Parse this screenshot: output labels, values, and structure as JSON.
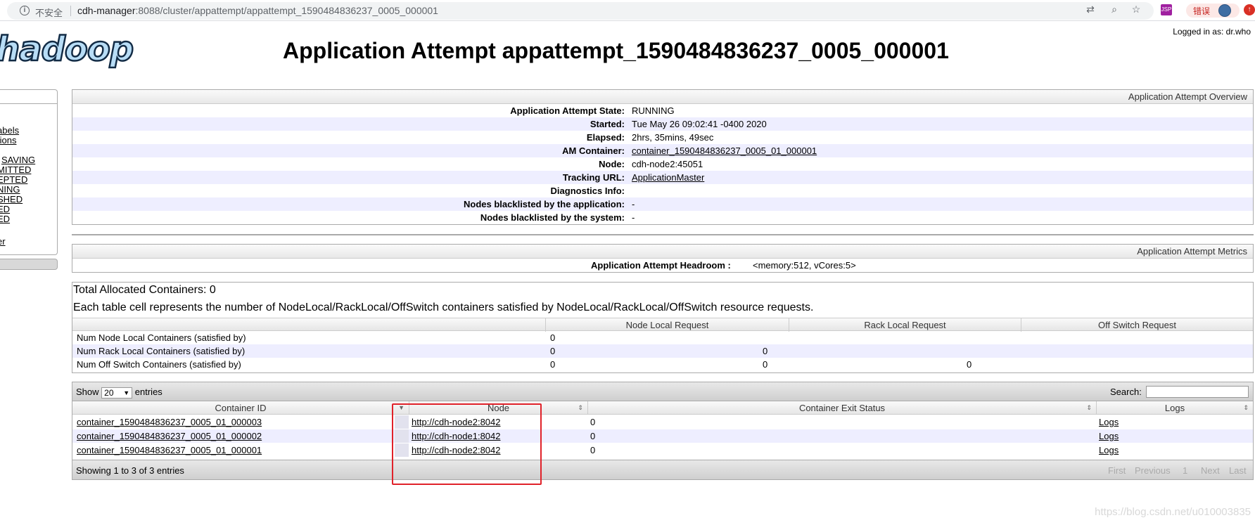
{
  "browser": {
    "security_label": "不安全",
    "url_host": "cdh-manager",
    "url_rest": ":8088/cluster/appattempt/appattempt_1590484836237_0005_000001",
    "error_label": "错误",
    "icons": [
      "info-icon",
      "translate-icon",
      "zoom-icon",
      "star-icon",
      "extension-icon",
      "avatar-icon",
      "update-icon"
    ]
  },
  "header": {
    "logged_in": "Logged in as: dr.who",
    "logo_text": "hadoop",
    "title": "Application Attempt appattempt_1590484836237_0005_000001"
  },
  "nav": {
    "items": [
      "abels",
      "tions",
      "",
      "SAVING",
      "MITTED",
      "EPTED",
      "NING",
      "SHED",
      "ED",
      "ED",
      "er"
    ]
  },
  "overview": {
    "heading": "Application Attempt Overview",
    "rows": [
      {
        "key": "Application Attempt State:",
        "value": "RUNNING",
        "link": false
      },
      {
        "key": "Started:",
        "value": "Tue May 26 09:02:41 -0400 2020",
        "link": false
      },
      {
        "key": "Elapsed:",
        "value": "2hrs, 35mins, 49sec",
        "link": false
      },
      {
        "key": "AM Container:",
        "value": "container_1590484836237_0005_01_000001",
        "link": true
      },
      {
        "key": "Node:",
        "value": "cdh-node2:45051",
        "link": false
      },
      {
        "key": "Tracking URL:",
        "value": "ApplicationMaster",
        "link": true
      },
      {
        "key": "Diagnostics Info:",
        "value": "",
        "link": false
      },
      {
        "key": "Nodes blacklisted by the application:",
        "value": "-",
        "link": false
      },
      {
        "key": "Nodes blacklisted by the system:",
        "value": "-",
        "link": false
      }
    ]
  },
  "metrics": {
    "heading": "Application Attempt Metrics",
    "headroom_key": "Application Attempt Headroom :",
    "headroom_value": "<memory:512, vCores:5>"
  },
  "allocation": {
    "total": "Total Allocated Containers: 0",
    "description": "Each table cell represents the number of NodeLocal/RackLocal/OffSwitch containers satisfied by NodeLocal/RackLocal/OffSwitch resource requests.",
    "columns": [
      "",
      "Node Local Request",
      "Rack Local Request",
      "Off Switch Request"
    ],
    "rows": [
      {
        "label": "Num Node Local Containers (satisfied by)",
        "values": [
          "0",
          "",
          ""
        ]
      },
      {
        "label": "Num Rack Local Containers (satisfied by)",
        "values": [
          "0",
          "0",
          ""
        ]
      },
      {
        "label": "Num Off Switch Containers (satisfied by)",
        "values": [
          "0",
          "0",
          "0"
        ]
      }
    ]
  },
  "containers": {
    "show_label": "Show",
    "page_size": "20",
    "entries_label": "entries",
    "search_label": "Search:",
    "columns": [
      "Container ID",
      "Node",
      "Container Exit Status",
      "Logs"
    ],
    "rows": [
      {
        "id": "container_1590484836237_0005_01_000003",
        "node": "http://cdh-node2:8042",
        "exit_status": "0",
        "logs": "Logs"
      },
      {
        "id": "container_1590484836237_0005_01_000002",
        "node": "http://cdh-node1:8042",
        "exit_status": "0",
        "logs": "Logs"
      },
      {
        "id": "container_1590484836237_0005_01_000001",
        "node": "http://cdh-node2:8042",
        "exit_status": "0",
        "logs": "Logs"
      }
    ],
    "info": "Showing 1 to 3 of 3 entries",
    "pager": [
      "First",
      "Previous",
      "1",
      "Next",
      "Last"
    ]
  },
  "watermark": "https://blog.csdn.net/u010003835",
  "colors": {
    "highlight": "#e0222a",
    "alt_row": "#eeeeff",
    "logo_fill": "#b8ddf6",
    "logo_stroke": "#122b45"
  }
}
